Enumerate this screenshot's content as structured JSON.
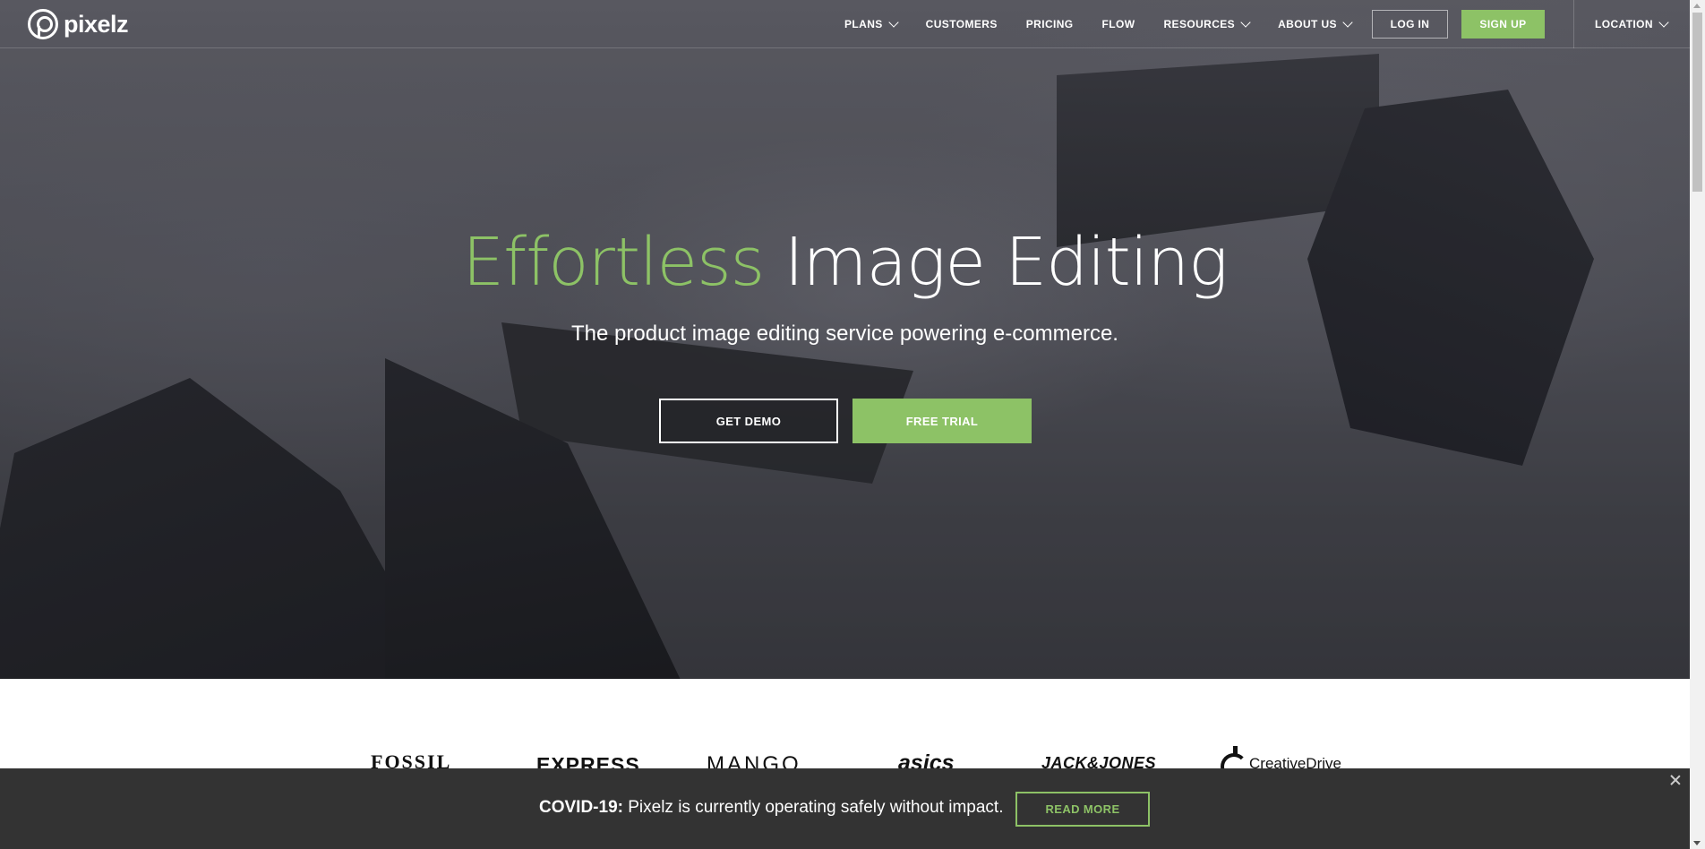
{
  "brand": {
    "name": "pixelz"
  },
  "nav": {
    "items": [
      {
        "label": "PLANS",
        "dropdown": true
      },
      {
        "label": "CUSTOMERS",
        "dropdown": false
      },
      {
        "label": "PRICING",
        "dropdown": false
      },
      {
        "label": "FLOW",
        "dropdown": false
      },
      {
        "label": "RESOURCES",
        "dropdown": true
      },
      {
        "label": "ABOUT US",
        "dropdown": true
      }
    ],
    "login_label": "LOG IN",
    "signup_label": "SIGN UP",
    "location_label": "LOCATION"
  },
  "hero": {
    "title_accent": "Effortless",
    "title_rest": " Image Editing",
    "subtitle": "The product image editing service powering e-commerce.",
    "demo_label": "GET DEMO",
    "trial_label": "FREE TRIAL"
  },
  "customers": {
    "logos": [
      "FOSSIL",
      "EXPRESS",
      "MANGO",
      "asics",
      "JACK&JONES",
      "CreativeDrive"
    ]
  },
  "covid_banner": {
    "label": "COVID-19:",
    "message": " Pixelz is currently operating safely without impact.",
    "button_label": "READ MORE"
  },
  "colors": {
    "accent": "#8dc266",
    "banner_bg": "#333333",
    "text_on_dark": "#ffffff"
  }
}
